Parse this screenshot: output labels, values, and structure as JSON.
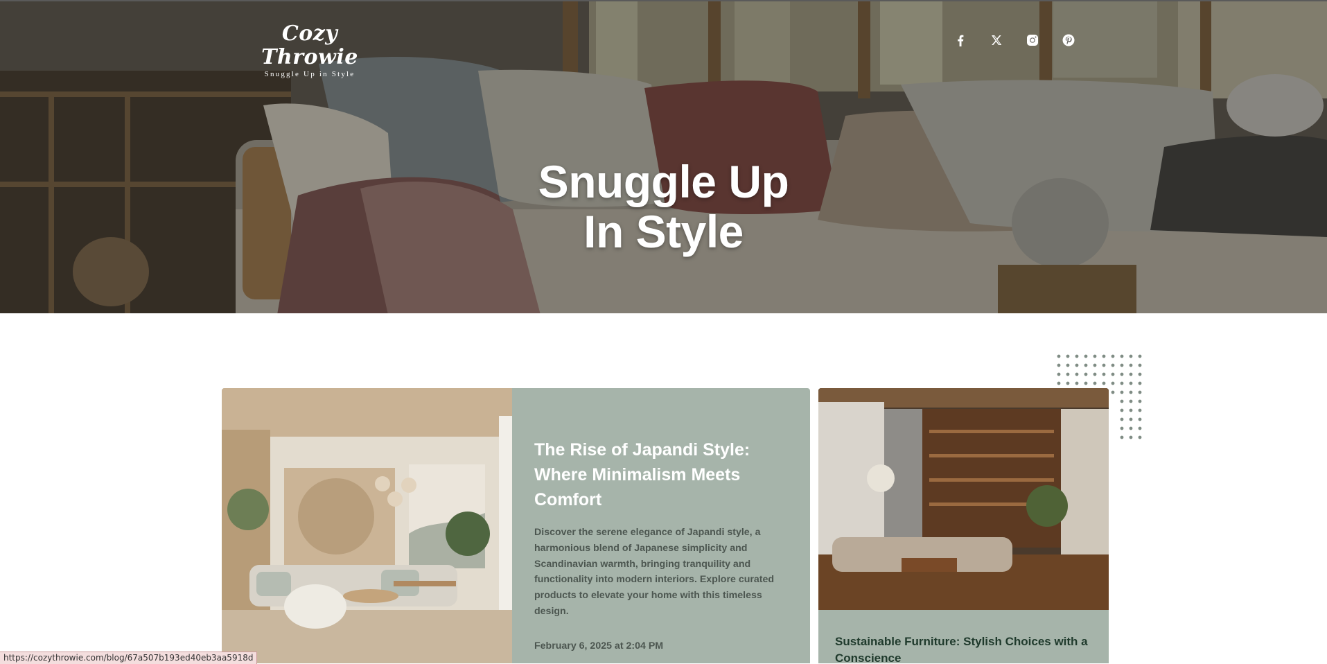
{
  "site": {
    "logo_name": "Cozy Throwie",
    "logo_tagline": "Snuggle Up in Style"
  },
  "hero": {
    "title_line1": "Snuggle Up",
    "title_line2": "In Style"
  },
  "social": [
    "facebook-icon",
    "x-icon",
    "instagram-icon",
    "pinterest-icon"
  ],
  "featured_post": {
    "title": "The Rise of Japandi Style: Where Minimalism Meets Comfort",
    "excerpt": "Discover the serene elegance of Japandi style, a harmonious blend of Japanese simplicity and Scandinavian warmth, bringing tranquility and functionality into modern interiors. Explore curated products to elevate your home with this timeless design.",
    "date": "February 6, 2025 at 2:04 PM"
  },
  "side_post": {
    "title": "Sustainable Furniture: Stylish Choices with a Conscience"
  },
  "status_bar": {
    "url": "https://cozythrowie.com/blog/67a507b193ed40eb3aa5918d"
  },
  "colors": {
    "card_bg": "#a6b4aa",
    "card_text_dark": "#4c5650",
    "side_title": "#1f3a2c",
    "dots": "#7f8c84"
  }
}
